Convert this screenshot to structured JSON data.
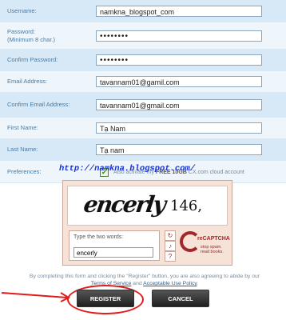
{
  "form": {
    "username": {
      "label": "Username:",
      "value": "namkna_blogspot_com"
    },
    "password": {
      "label": "Password:",
      "hint": "(Minimum 8 char.)",
      "value": "••••••••"
    },
    "confirm_password": {
      "label": "Confirm Password:",
      "value": "••••••••"
    },
    "email": {
      "label": "Email Address:",
      "value": "tavannam01@gamil.com"
    },
    "confirm_email": {
      "label": "Confirm Email Address:",
      "value": "tavannam01@gmail.com"
    },
    "first_name": {
      "label": "First Name:",
      "value": "Tạ Nam"
    },
    "last_name": {
      "label": "Last Name:",
      "value": "Tạ nam"
    },
    "preferences": {
      "label": "Preferences:",
      "checkbox_text_pre": "Also activate my ",
      "checkbox_text_bold": "FREE 10GB",
      "checkbox_text_post": " CX.com cloud account",
      "checked": true
    }
  },
  "watermark": "http://namkna.blogspot.com/",
  "captcha": {
    "word1": "encerly",
    "word2": "146,",
    "prompt": "Type the two words:",
    "answer": "encerly",
    "logo_name": "reCAPTCHA",
    "tagline1": "stop spam.",
    "tagline2": "read books."
  },
  "terms": {
    "text": "By completing this form and clicking the \"Register\" button, you are also agreeing to abide by our",
    "tos_link": "Terms of Service",
    "and": " and ",
    "aup_link": "Acceptable Use Policy",
    "end": "."
  },
  "buttons": {
    "register": "REGISTER",
    "cancel": "CANCEL"
  },
  "colors": {
    "accent": "#4a7aa3",
    "highlight_ring": "#e01c1c",
    "watermark": "#1a33cc"
  }
}
